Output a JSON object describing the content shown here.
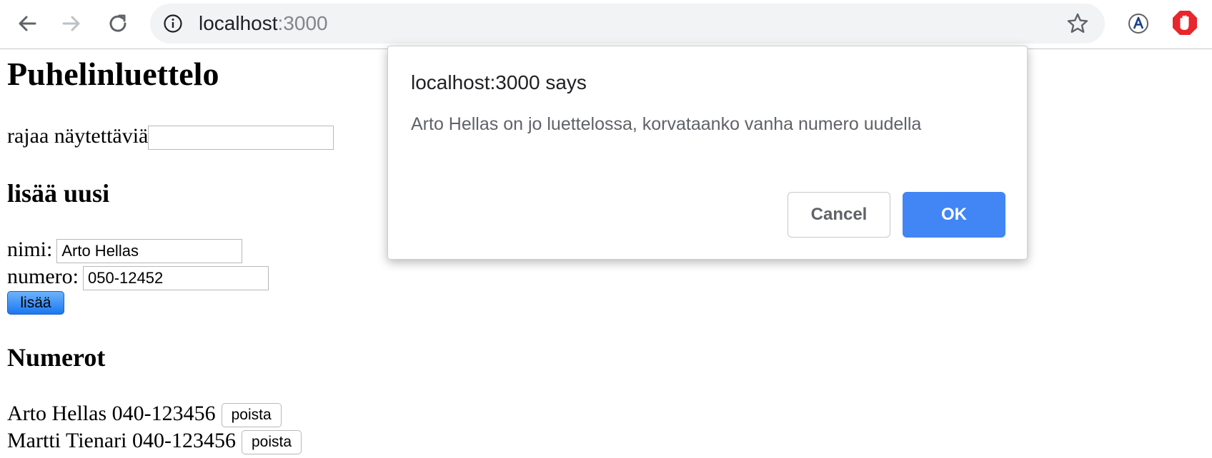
{
  "browser": {
    "url_host": "localhost",
    "url_port": ":3000",
    "icons": {
      "back": "back-arrow-icon",
      "forward": "forward-arrow-icon",
      "reload": "reload-icon",
      "info": "info-icon",
      "bookmark": "star-icon",
      "translate": "translate-extension-icon",
      "adblock": "adblock-extension-icon"
    }
  },
  "page": {
    "title": "Puhelinluettelo",
    "filter_label": "rajaa näytettäviä",
    "filter_value": "",
    "add_section_title": "lisää uusi",
    "name_label": "nimi:",
    "name_value": "Arto Hellas",
    "number_label": "numero:",
    "number_value": "050-12452",
    "add_button": "lisää",
    "numbers_title": "Numerot",
    "entries": [
      {
        "text": "Arto Hellas 040-123456",
        "button": "poista"
      },
      {
        "text": "Martti Tienari 040-123456",
        "button": "poista"
      }
    ]
  },
  "dialog": {
    "title": "localhost:3000 says",
    "message": "Arto Hellas on jo luettelossa, korvataanko vanha numero uudella",
    "cancel_label": "Cancel",
    "ok_label": "OK"
  },
  "colors": {
    "ok_button": "#4285f4",
    "omnibox_bg": "#f1f3f4",
    "adblock_red": "#e8262c"
  }
}
